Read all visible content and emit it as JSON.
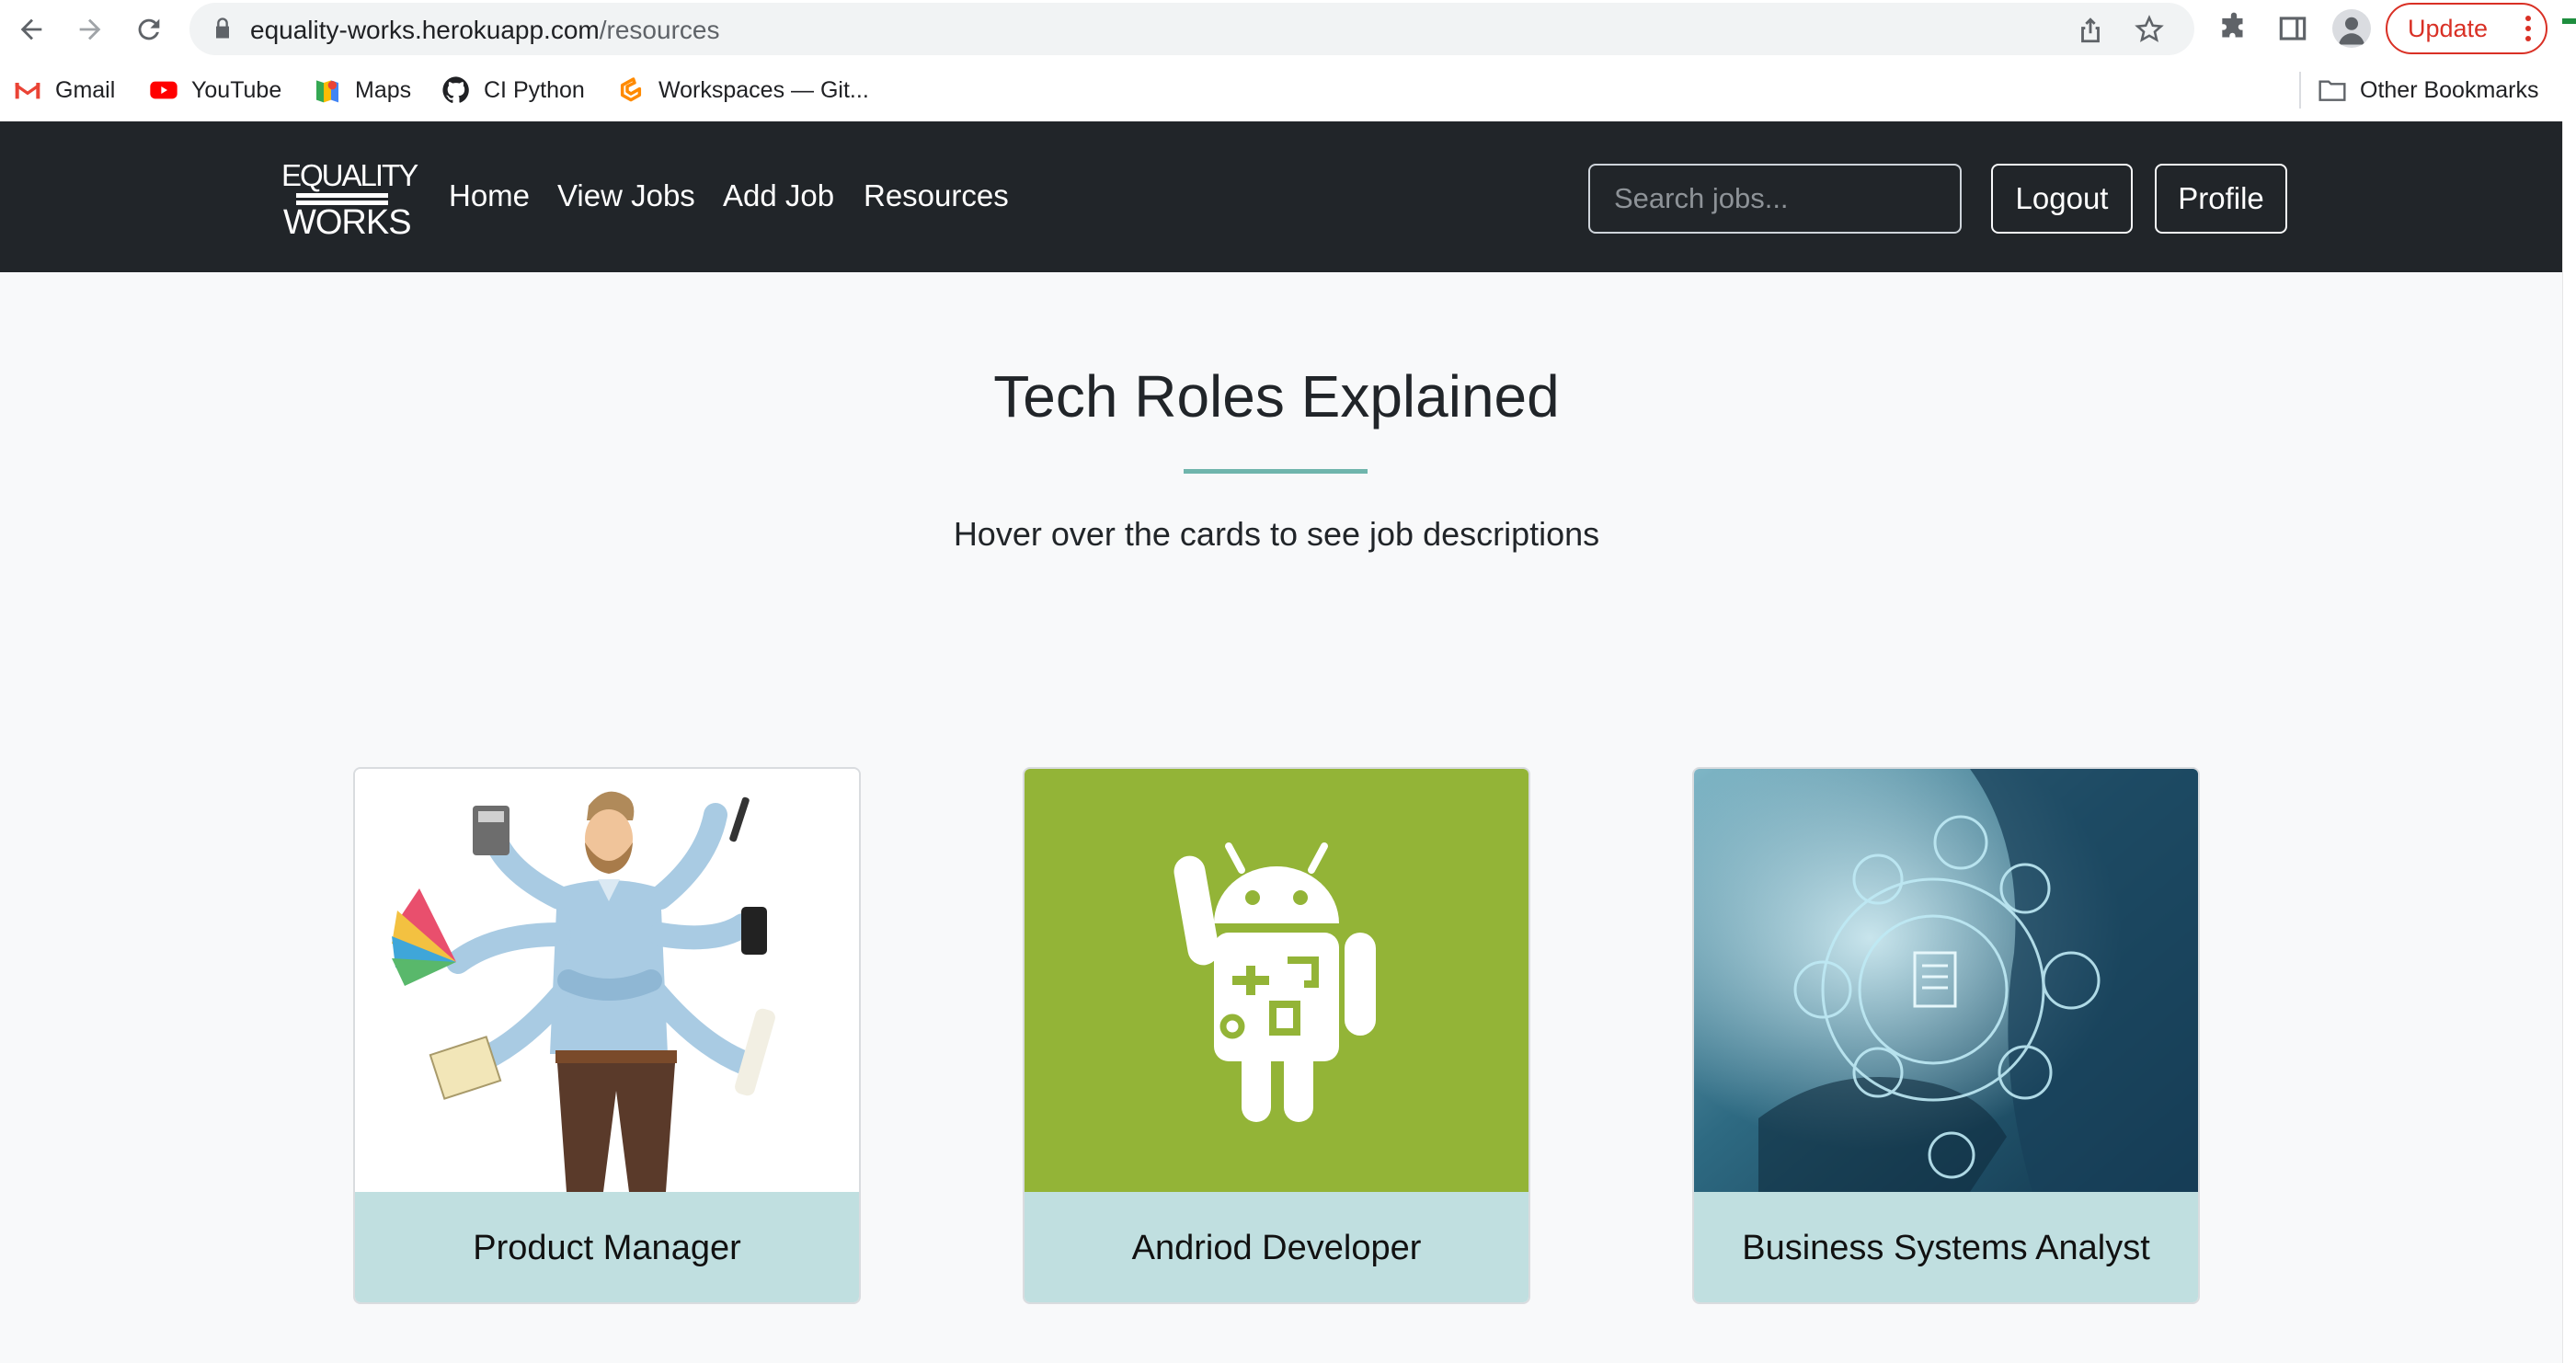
{
  "browser": {
    "url_host": "equality-works.herokuapp.com",
    "url_path": "/resources",
    "update_label": "Update",
    "bookmarks": [
      {
        "label": "Gmail",
        "icon": "gmail-icon"
      },
      {
        "label": "YouTube",
        "icon": "youtube-icon"
      },
      {
        "label": "Maps",
        "icon": "maps-icon"
      },
      {
        "label": "CI Python",
        "icon": "github-icon"
      },
      {
        "label": "Workspaces — Git...",
        "icon": "gitpod-icon"
      }
    ],
    "other_bookmarks": "Other Bookmarks"
  },
  "navbar": {
    "logo_top": "EQUALITY",
    "logo_bottom": "WORKS",
    "links": [
      "Home",
      "View Jobs",
      "Add Job",
      "Resources"
    ],
    "search_placeholder": "Search jobs...",
    "logout_label": "Logout",
    "profile_label": "Profile"
  },
  "main": {
    "title": "Tech Roles Explained",
    "subtitle": "Hover over the cards to see job descriptions",
    "cards": [
      {
        "label": "Product Manager",
        "image": "multitasking-person-illustration"
      },
      {
        "label": "Andriod Developer",
        "image": "android-robot-illustration"
      },
      {
        "label": "Business Systems Analyst",
        "image": "business-tech-icons-photo"
      }
    ]
  },
  "colors": {
    "navbar_bg": "#212529",
    "page_bg": "#f8f9fa",
    "accent_rule": "#6fb5ac",
    "card_footer_bg": "#c0dfe0",
    "android_green": "#93b437",
    "update_red": "#d93025"
  }
}
